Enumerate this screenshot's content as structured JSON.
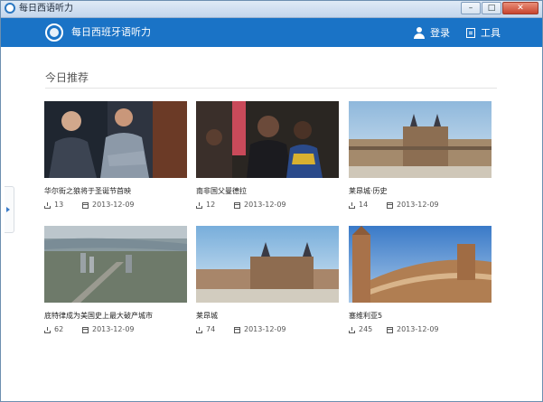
{
  "window": {
    "title": "每日西语听力",
    "buttons": {
      "minimize": "–",
      "maximize": "□",
      "close": "✕"
    }
  },
  "header": {
    "app_name": "每日西班牙语听力",
    "login_label": "登录",
    "tools_label": "工具"
  },
  "section": {
    "title": "今日推荐"
  },
  "cards": [
    {
      "title": "华尔街之狼将于圣诞节首映",
      "downloads": "13",
      "date": "2013-12-09"
    },
    {
      "title": "南非国父曼德拉",
      "downloads": "12",
      "date": "2013-12-09"
    },
    {
      "title": "莱昂城·历史",
      "downloads": "14",
      "date": "2013-12-09"
    },
    {
      "title": "底特律成为美国史上最大破产城市",
      "downloads": "62",
      "date": "2013-12-09"
    },
    {
      "title": "莱昂城",
      "downloads": "74",
      "date": "2013-12-09"
    },
    {
      "title": "塞维利亚5",
      "downloads": "245",
      "date": "2013-12-09"
    }
  ]
}
